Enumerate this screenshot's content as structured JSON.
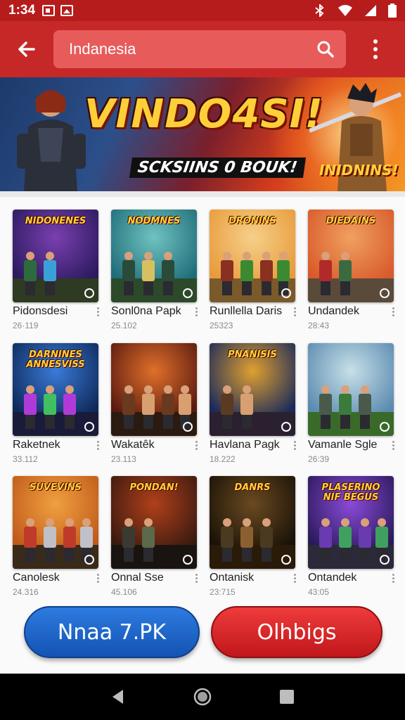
{
  "status_bar": {
    "time": "1:34",
    "icons": [
      "instagram-icon",
      "photo-icon",
      "bluetooth-icon",
      "wifi-icon",
      "signal-icon",
      "battery-icon"
    ]
  },
  "app_bar": {
    "back_icon": "back-arrow-icon",
    "search_text": "Indanesia",
    "search_icon": "search-icon",
    "more_icon": "more-vert-icon"
  },
  "banner": {
    "title": "VINDO4SI!",
    "subtitle": "SCKSIINS 0 BOUK!",
    "tag": "INIDNINS!"
  },
  "apps": [
    {
      "name": "Pidonsdesi",
      "meta": "26·119",
      "thumb_text": "NIDONENES"
    },
    {
      "name": "Sonl0na Papk",
      "meta": "25.102",
      "thumb_text": "NODMNES"
    },
    {
      "name": "Runllella Daris",
      "meta": "25323",
      "thumb_text": "DRONINS"
    },
    {
      "name": "Undandek",
      "meta": "28:43",
      "thumb_text": "DIEDAINS"
    },
    {
      "name": "Raketnek",
      "meta": "33.112",
      "thumb_text": "DARNINES ANNESVISS"
    },
    {
      "name": "Wakatêk",
      "meta": "23.113",
      "thumb_text": ""
    },
    {
      "name": "Havlana Pagk",
      "meta": "18.222",
      "thumb_text": "PNANISIS"
    },
    {
      "name": "Vamanle Sgle",
      "meta": "26:39",
      "thumb_text": ""
    },
    {
      "name": "Canolesk",
      "meta": "24.316",
      "thumb_text": "SUVEVINS"
    },
    {
      "name": "Onnal Sse",
      "meta": "45.106",
      "thumb_text": "PONDAN!"
    },
    {
      "name": "Ontanisk",
      "meta": "23:715",
      "thumb_text": "DANRS"
    },
    {
      "name": "Ontandek",
      "meta": "43:05",
      "thumb_text": "PLASERINO NIF BEGUS"
    }
  ],
  "buttons": {
    "primary": "Nnaa 7.PK",
    "secondary": "Olhbigs"
  },
  "nav": {
    "back": "nav-back-icon",
    "home": "nav-home-icon",
    "recents": "nav-recents-icon"
  },
  "colors": {
    "app_bar": "#c62828",
    "status_bar": "#b71c1c",
    "primary_button": "#1f66c9",
    "secondary_button": "#d92626"
  }
}
